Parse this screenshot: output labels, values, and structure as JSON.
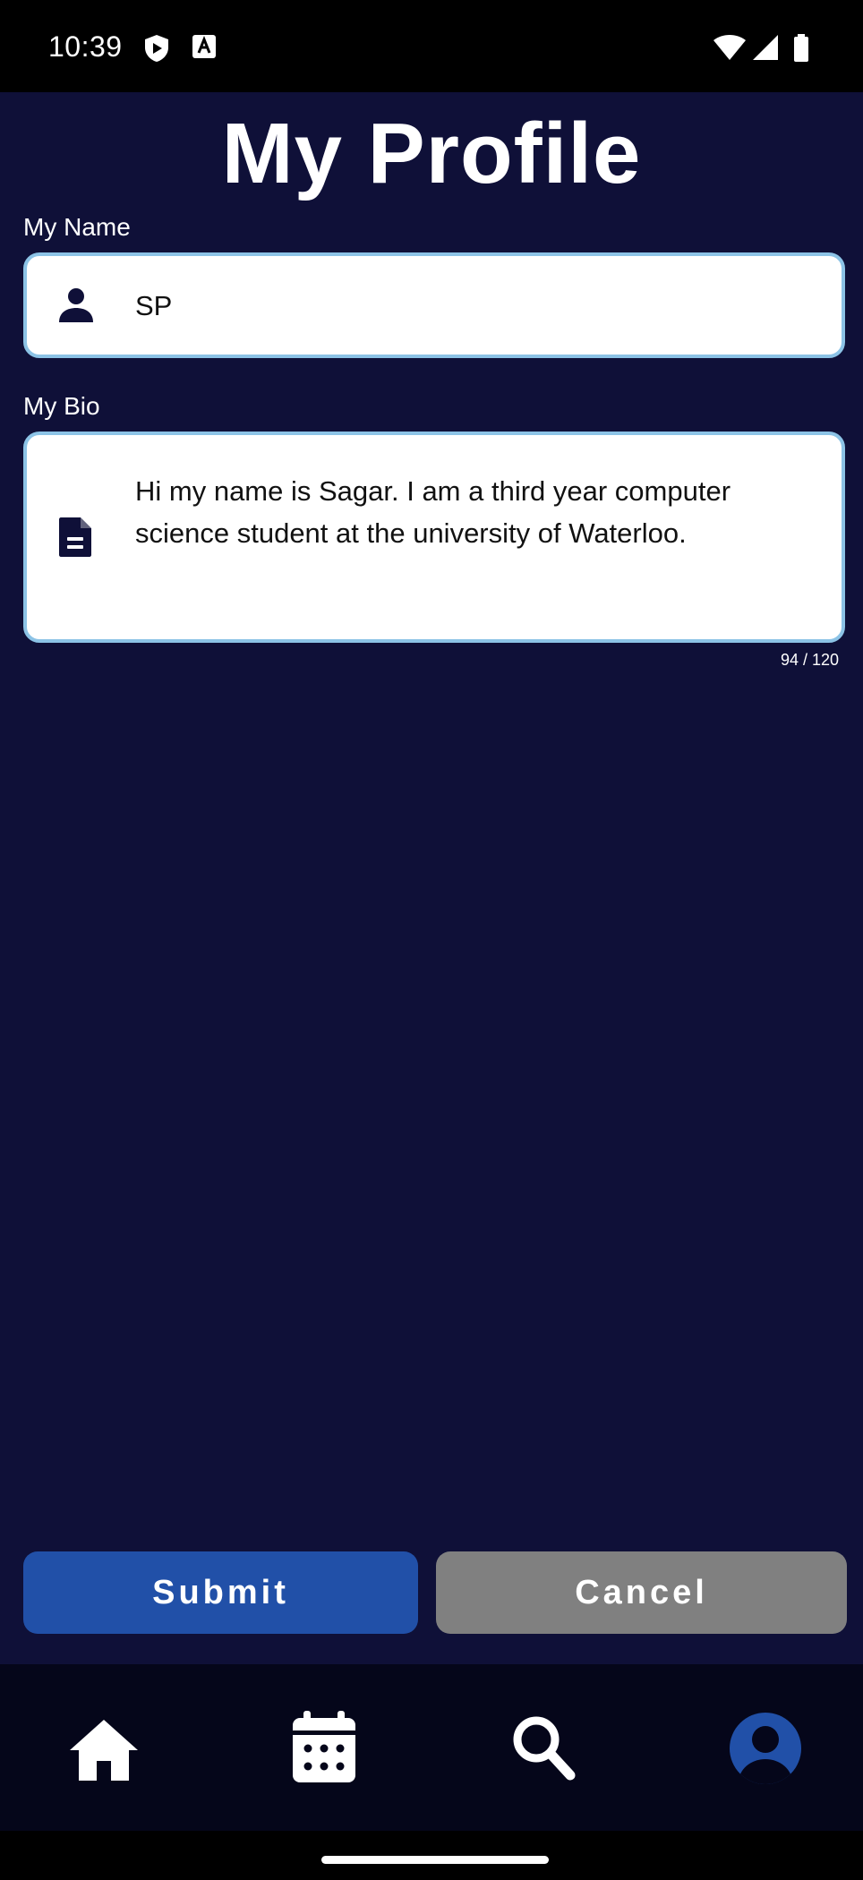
{
  "status_bar": {
    "time": "10:39",
    "icons": [
      "shield-icon",
      "font-a-icon",
      "wifi-icon",
      "signal-icon",
      "battery-icon"
    ]
  },
  "page": {
    "title": "My Profile"
  },
  "name_field": {
    "label": "My Name",
    "value": "SP",
    "icon": "person-icon"
  },
  "bio_field": {
    "label": "My Bio",
    "value_lines": [
      "Hi my name is Sagar. I am a third year computer",
      "science student at the university of Waterloo."
    ],
    "counter": "94 / 120",
    "icon": "document-icon"
  },
  "actions": {
    "submit": "Submit",
    "cancel": "Cancel"
  },
  "bottom_nav": {
    "items": [
      {
        "icon": "home-icon"
      },
      {
        "icon": "calendar-icon"
      },
      {
        "icon": "search-icon"
      },
      {
        "icon": "profile-icon",
        "active": true
      }
    ]
  },
  "colors": {
    "background": "#0f1038",
    "field_border": "#8cc3e6",
    "submit": "#2150a8",
    "cancel": "#808080",
    "active_nav": "#2150a8"
  }
}
